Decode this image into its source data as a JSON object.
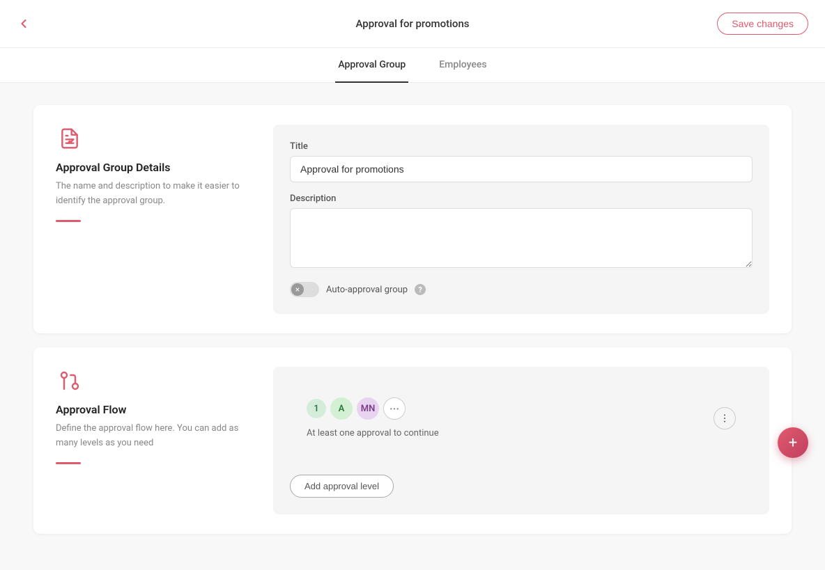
{
  "header": {
    "title": "Approval for promotions",
    "save_label": "Save changes"
  },
  "tabs": [
    {
      "id": "approval-group",
      "label": "Approval Group",
      "active": true
    },
    {
      "id": "employees",
      "label": "Employees",
      "active": false
    }
  ],
  "approval_group_section": {
    "icon_name": "document-edit-icon",
    "title": "Approval Group Details",
    "description": "The name and description to make it easier to identify the approval group.",
    "form": {
      "title_label": "Title",
      "title_value": "Approval for promotions",
      "title_placeholder": "",
      "description_label": "Description",
      "description_value": "",
      "description_placeholder": "",
      "toggle_label": "Auto-approval group",
      "help_tooltip": "?"
    }
  },
  "approval_flow_section": {
    "icon_name": "flow-icon",
    "title": "Approval Flow",
    "description": "Define the approval flow here. You can add as many levels as you need",
    "flow_step": {
      "step_number": "1",
      "avatars": [
        {
          "initials": "A",
          "color_class": "avatar-a"
        },
        {
          "initials": "MN",
          "color_class": "avatar-mn"
        }
      ],
      "more_label": "···",
      "flow_text": "At least one approval to continue"
    },
    "add_level_label": "Add approval level"
  },
  "fab": {
    "icon": "+"
  }
}
